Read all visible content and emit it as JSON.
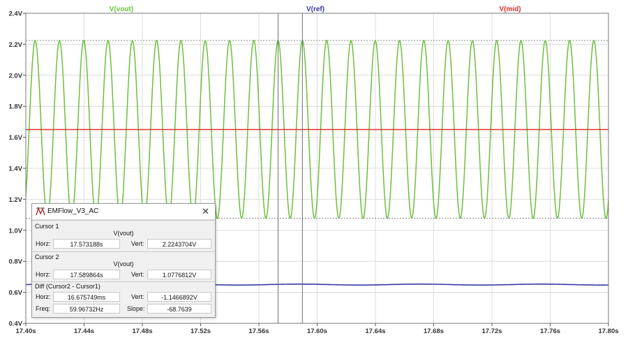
{
  "window": {
    "title": "EMFlow_V3_AC"
  },
  "traces": [
    {
      "name": "V(vout)",
      "color": "#6cbf3c"
    },
    {
      "name": "V(ref)",
      "color": "#3838a8"
    },
    {
      "name": "V(mid)",
      "color": "#e0302a"
    }
  ],
  "chart_data": {
    "type": "line",
    "x_axis": {
      "range": [
        17.4,
        17.8
      ],
      "ticks": [
        "17.40s",
        "17.44s",
        "17.48s",
        "17.52s",
        "17.56s",
        "17.60s",
        "17.64s",
        "17.68s",
        "17.72s",
        "17.76s",
        "17.80s"
      ]
    },
    "y_axis": {
      "range": [
        0.4,
        2.4
      ],
      "ticks": [
        "2.4V",
        "2.2V",
        "2.0V",
        "1.8V",
        "1.6V",
        "1.4V",
        "1.2V",
        "1.0V",
        "0.8V",
        "0.6V",
        "0.4V"
      ]
    },
    "grid": true,
    "series": [
      {
        "name": "V(vout)",
        "kind": "sine",
        "min": 1.0776812,
        "max": 2.2243704,
        "frequency_hz": 59.96732,
        "peak_time": 17.573188
      },
      {
        "name": "V(ref)",
        "kind": "constant",
        "value": 0.65
      },
      {
        "name": "V(mid)",
        "kind": "constant",
        "value": 1.65
      }
    ],
    "cursors": [
      {
        "x": 17.573188,
        "y": 2.2243704
      },
      {
        "x": 17.589864,
        "y": 1.0776812
      }
    ]
  },
  "cursor_panel": {
    "cursor1": {
      "label": "Cursor 1",
      "trace": "V(vout)",
      "horz_label": "Horz:",
      "horz": "17.573188s",
      "vert_label": "Vert:",
      "vert": "2.2243704V"
    },
    "cursor2": {
      "label": "Cursor 2",
      "trace": "V(vout)",
      "horz_label": "Horz:",
      "horz": "17.589864s",
      "vert_label": "Vert:",
      "vert": "1.0776812V"
    },
    "diff": {
      "label": "Diff (Cursor2 - Cursor1)",
      "horz_label": "Horz:",
      "horz": "16.675749ms",
      "vert_label": "Vert:",
      "vert": "-1.1466892V",
      "freq_label": "Freq:",
      "freq": "59.96732Hz",
      "slope_label": "Slope:",
      "slope": "-68.7639"
    }
  }
}
